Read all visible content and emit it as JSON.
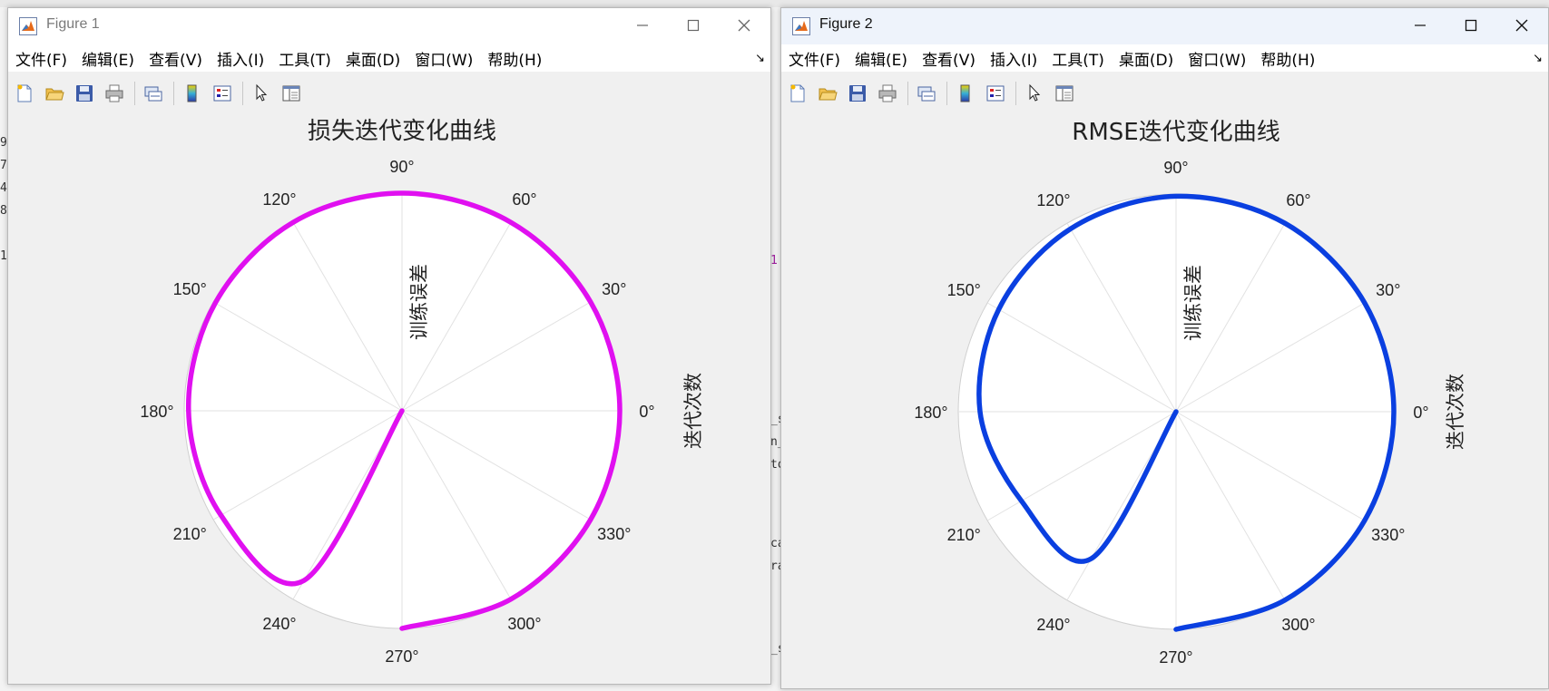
{
  "windows": [
    {
      "title": "Figure 1",
      "menu": [
        "文件(F)",
        "编辑(E)",
        "查看(V)",
        "插入(I)",
        "工具(T)",
        "桌面(D)",
        "窗口(W)",
        "帮助(H)"
      ],
      "menu_overflow": "↘",
      "toolbar_icons": [
        "new-figure-icon",
        "open-file-icon",
        "save-icon",
        "print-icon",
        "link-plot-icon",
        "colorbar-icon",
        "legend-icon",
        "pointer-icon",
        "property-inspector-icon"
      ],
      "chart_data": {
        "type": "polar-line",
        "title": "损失迭代变化曲线",
        "theta_label": "训练误差",
        "r_label": "迭代次数",
        "theta_ticks": [
          "0°",
          "30°",
          "60°",
          "90°",
          "120°",
          "150°",
          "180°",
          "210°",
          "240°",
          "270°",
          "300°",
          "330°"
        ],
        "line_color": "#e010f0",
        "series": [
          {
            "theta_deg": [
              -90,
              -60,
              -30,
              0,
              30,
              60,
              90,
              120,
              150,
              180,
              210,
              240,
              270
            ],
            "r_frac": [
              1.0,
              1.0,
              1.0,
              1.0,
              1.0,
              1.0,
              1.0,
              1.0,
              0.99,
              0.98,
              0.96,
              0.9,
              0.0
            ]
          }
        ]
      }
    },
    {
      "title": "Figure 2",
      "menu": [
        "文件(F)",
        "编辑(E)",
        "查看(V)",
        "插入(I)",
        "工具(T)",
        "桌面(D)",
        "窗口(W)",
        "帮助(H)"
      ],
      "menu_overflow": "↘",
      "toolbar_icons": [
        "new-figure-icon",
        "open-file-icon",
        "save-icon",
        "print-icon",
        "link-plot-icon",
        "colorbar-icon",
        "legend-icon",
        "pointer-icon",
        "property-inspector-icon"
      ],
      "chart_data": {
        "type": "polar-line",
        "title": "RMSE迭代变化曲线",
        "theta_label": "训练误差",
        "r_label": "迭代次数",
        "theta_ticks": [
          "0°",
          "30°",
          "60°",
          "90°",
          "120°",
          "150°",
          "180°",
          "210°",
          "240°",
          "270°",
          "300°",
          "330°"
        ],
        "line_color": "#0a3fe0",
        "series": [
          {
            "theta_deg": [
              -90,
              -60,
              -30,
              0,
              30,
              60,
              90,
              120,
              150,
              180,
              210,
              240,
              270
            ],
            "r_frac": [
              1.0,
              1.0,
              1.0,
              1.0,
              1.0,
              1.0,
              0.99,
              0.97,
              0.94,
              0.9,
              0.82,
              0.78,
              0.0
            ]
          }
        ]
      }
    }
  ],
  "background_fragments": [
    "9",
    "7",
    "4",
    "8",
    "1",
    "1",
    "_s",
    "n_",
    "to",
    "ca",
    "ra",
    "_s"
  ]
}
